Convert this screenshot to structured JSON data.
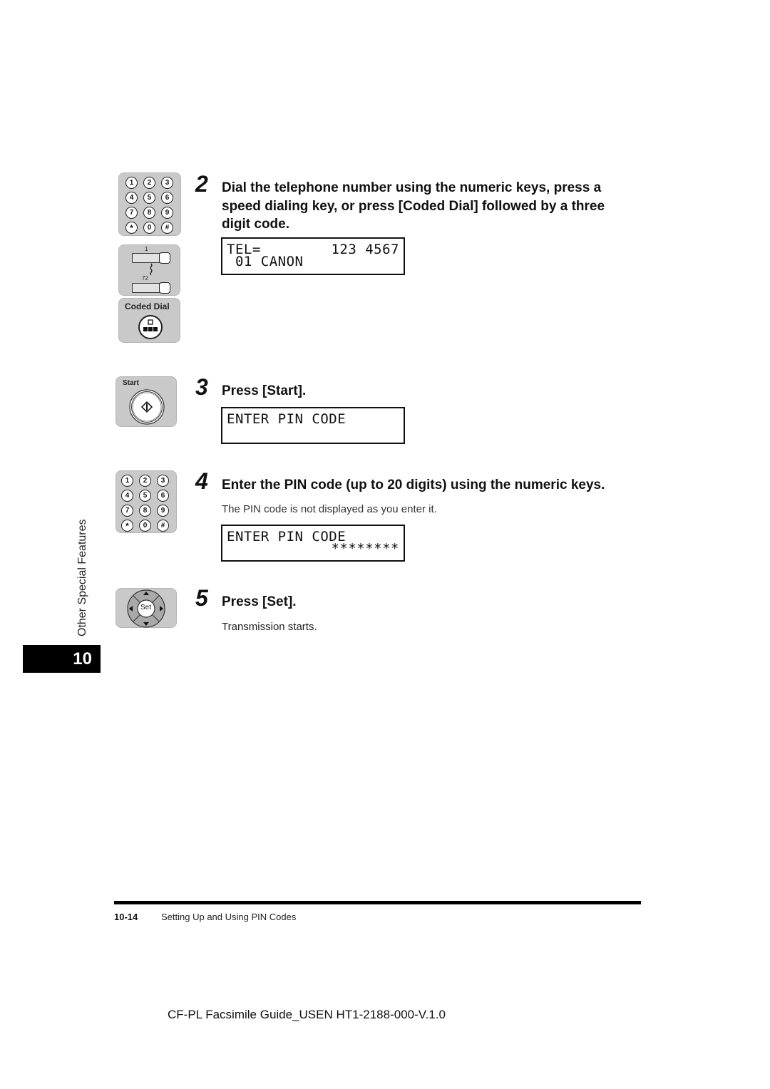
{
  "side_tab": {
    "label": "Other Special Features",
    "chapter": "10"
  },
  "keypad": {
    "keys": [
      "1",
      "2",
      "3",
      "4",
      "5",
      "6",
      "7",
      "8",
      "9",
      "*",
      "0",
      "#"
    ]
  },
  "speed_dial_panel": {
    "first": "1",
    "last": "72"
  },
  "coded_dial_panel": {
    "label": "Coded Dial"
  },
  "start_panel": {
    "label": "Start"
  },
  "set_panel": {
    "label": "Set"
  },
  "steps": [
    {
      "number": "2",
      "title_lines": [
        "Dial the telephone number using the numeric keys, press a",
        "speed dialing key, or press [Coded Dial] followed by a three",
        "digit code."
      ],
      "lcd": {
        "line1_left": "TEL=",
        "line1_right": "123 4567",
        "line2": " 01 CANON"
      }
    },
    {
      "number": "3",
      "title": "Press [Start].",
      "lcd": {
        "line1": "ENTER PIN CODE",
        "line2": ""
      }
    },
    {
      "number": "4",
      "title": "Enter the PIN code (up to 20 digits) using the numeric keys.",
      "note": "The PIN code is not displayed as you enter it.",
      "lcd": {
        "line1": "ENTER PIN CODE",
        "line2": "********"
      }
    },
    {
      "number": "5",
      "title": "Press [Set].",
      "note": "Transmission starts."
    }
  ],
  "footer": {
    "page": "10-14",
    "section": "Setting Up and Using PIN Codes",
    "doc_id": "CF-PL Facsimile Guide_USEN HT1-2188-000-V.1.0"
  }
}
